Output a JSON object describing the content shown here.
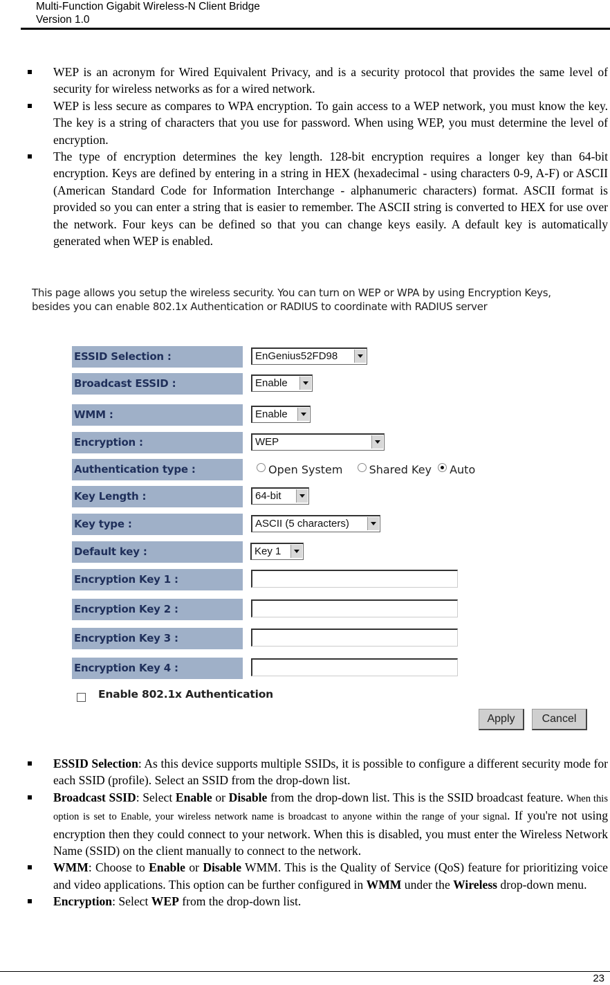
{
  "header": {
    "title": "Multi-Function Gigabit Wireless-N Client Bridge",
    "version": "Version 1.0"
  },
  "top_bullets": [
    "WEP is an acronym for Wired Equivalent Privacy, and is a security protocol that provides the same level of security for wireless networks as for a wired network.",
    "WEP is less secure as compares to WPA encryption. To gain access to a WEP network, you must know the key. The key is a string of characters that you use for password. When using WEP, you must determine the level of encryption.",
    "The type of encryption determines the key length. 128-bit encryption requires a longer key than 64-bit encryption. Keys are defined by entering in a string in HEX (hexadecimal - using characters 0-9, A-F) or ASCII (American Standard Code for Information Interchange - alphanumeric characters) format. ASCII format is provided so you can enter a string that is easier to remember. The ASCII string is converted to HEX for use over the network. Four keys can be defined so that you can change keys easily. A default key is automatically generated when WEP is enabled."
  ],
  "ui": {
    "intro": "This page allows you setup the wireless security. You can turn on WEP or WPA by using Encryption Keys, besides you can enable 802.1x Authentication or RADIUS to coordinate with RADIUS server",
    "labels": {
      "essid": "ESSID Selection :",
      "broadcast": "Broadcast ESSID :",
      "wmm": "WMM :",
      "encryption": "Encryption :",
      "auth": "Authentication type :",
      "key_length": "Key Length :",
      "key_type": "Key type :",
      "default_key": "Default key :",
      "key1": "Encryption Key 1 :",
      "key2": "Encryption Key 2 :",
      "key3": "Encryption Key 3 :",
      "key4": "Encryption Key 4 :"
    },
    "values": {
      "essid": "EnGenius52FD98",
      "broadcast": "Enable",
      "wmm": "Enable",
      "encryption": "WEP",
      "key_length": "64-bit",
      "key_type": "ASCII (5 characters)",
      "default_key": "Key 1",
      "key1": "",
      "key2": "",
      "key3": "",
      "key4": ""
    },
    "auth_options": [
      {
        "label": "Open System",
        "selected": false
      },
      {
        "label": "Shared Key",
        "selected": false
      },
      {
        "label": "Auto",
        "selected": true
      }
    ],
    "enable_8021x": {
      "label": "Enable 802.1x Authentication",
      "checked": false
    },
    "apply_label": "Apply",
    "cancel_label": "Cancel"
  },
  "bottom_bullets": {
    "essid": {
      "term": "ESSID Selection",
      "text": ": As this device supports multiple SSIDs, it is possible to configure a different security mode for each SSID (profile). Select an SSID from the drop-down list."
    },
    "broadcast": {
      "term": "Broadcast SSID",
      "t1": ": Select ",
      "b1": "Enable",
      "t2": " or ",
      "b2": "Disable",
      "t3": " from the drop-down list. This is the SSID broadcast feature. ",
      "small": "When this option is set to Enable, your wireless network name is broadcast to anyone within the range of your signal",
      "t4": ". If you're not using encryption then they could connect to your network. When this is disabled, you must enter the Wireless Network Name (SSID) on the client manually to connect to the network."
    },
    "wmm": {
      "term": "WMM",
      "t1": ": Choose to ",
      "b1": "Enable",
      "t2": " or ",
      "b2": "Disable",
      "t3": " WMM. This is the Quality of Service (QoS) feature for prioritizing voice and video applications. This option can be further configured in ",
      "b3": "WMM",
      "t4": " under the ",
      "b4": "Wireless",
      "t5": " drop-down menu."
    },
    "encryption": {
      "term": "Encryption",
      "t1": ": Select ",
      "b1": "WEP",
      "t2": " from the drop-down list."
    }
  },
  "footer": {
    "page_number": "23"
  }
}
